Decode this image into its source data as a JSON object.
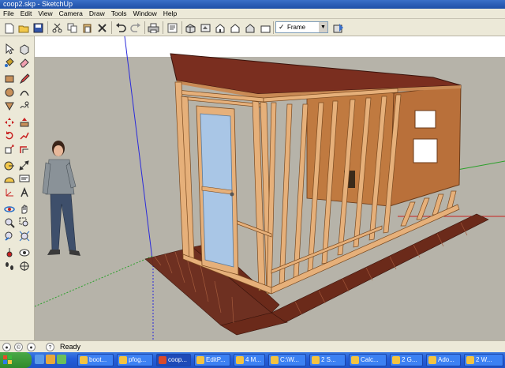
{
  "window": {
    "title": "coop2.skp - SketchUp"
  },
  "menubar": {
    "items": [
      "File",
      "Edit",
      "View",
      "Camera",
      "Draw",
      "Tools",
      "Window",
      "Help"
    ]
  },
  "toolbar": {
    "scene_checkmark": "✓",
    "scene_selected": "Frame"
  },
  "statusbar": {
    "text": "Ready",
    "help_icon": "?"
  },
  "taskbar": {
    "items": [
      "boot...",
      "pfog...",
      "coop...",
      "EditP...",
      "4 M...",
      "C:\\W...",
      "2 S...",
      "Calc...",
      "2 G...",
      "Ado...",
      "2 W..."
    ]
  },
  "colors": {
    "ground": "#b6b3a9",
    "sky": "#ffffff",
    "wood_frame": "#e6b07a",
    "roof": "#7a2e1f",
    "plywood": "#b9703a",
    "pavers": "#6b2a1a",
    "door_glass": "#a9c6e6"
  }
}
